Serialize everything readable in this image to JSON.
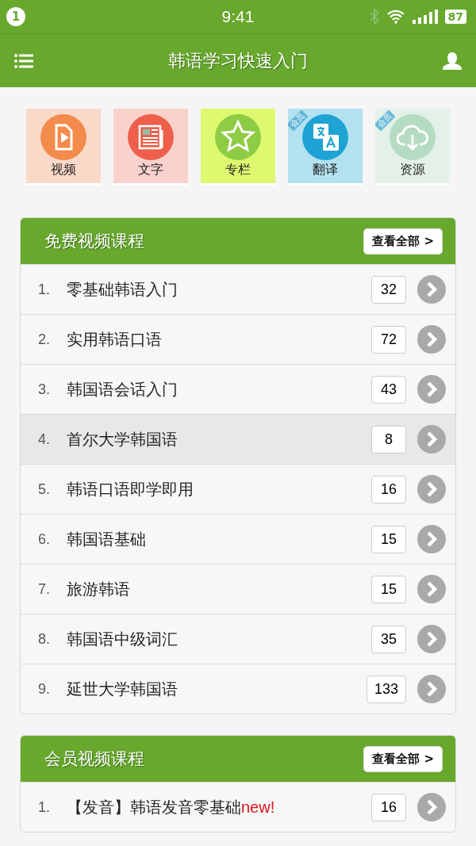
{
  "status_bar": {
    "notification": "1",
    "time": "9:41",
    "battery": "87"
  },
  "app_bar": {
    "title": "韩语学习快速入门"
  },
  "tiles": [
    {
      "label": "视频",
      "kind": "video",
      "color": "#f28b4c"
    },
    {
      "label": "文字",
      "kind": "news",
      "color": "#ee604b"
    },
    {
      "label": "专栏",
      "kind": "star",
      "color": "#8fcc45"
    },
    {
      "label": "翻译",
      "kind": "translate",
      "color": "#1ea3d4",
      "badge": "会员"
    },
    {
      "label": "资源",
      "kind": "cloud",
      "color": "#b5dbc3",
      "badge": "会员"
    }
  ],
  "sections": [
    {
      "title": "免费视频课程",
      "more": "查看全部 >",
      "rows": [
        {
          "index": "1.",
          "title": "零基础韩语入门",
          "count": "32",
          "selected": false
        },
        {
          "index": "2.",
          "title": "实用韩语口语",
          "count": "72",
          "selected": false
        },
        {
          "index": "3.",
          "title": "韩国语会话入门",
          "count": "43",
          "selected": false
        },
        {
          "index": "4.",
          "title": "首尔大学韩国语",
          "count": "8",
          "selected": true
        },
        {
          "index": "5.",
          "title": "韩语口语即学即用",
          "count": "16",
          "selected": false
        },
        {
          "index": "6.",
          "title": "韩国语基础",
          "count": "15",
          "selected": false
        },
        {
          "index": "7.",
          "title": "旅游韩语",
          "count": "15",
          "selected": false
        },
        {
          "index": "8.",
          "title": "韩国语中级词汇",
          "count": "35",
          "selected": false
        },
        {
          "index": "9.",
          "title": "延世大学韩国语",
          "count": "133",
          "selected": false
        }
      ]
    },
    {
      "title": "会员视频课程",
      "more": "查看全部 >",
      "rows": [
        {
          "index": "1.",
          "title": "【发音】韩语发音零基础",
          "tag": "new!",
          "count": "16",
          "selected": false
        }
      ]
    }
  ]
}
